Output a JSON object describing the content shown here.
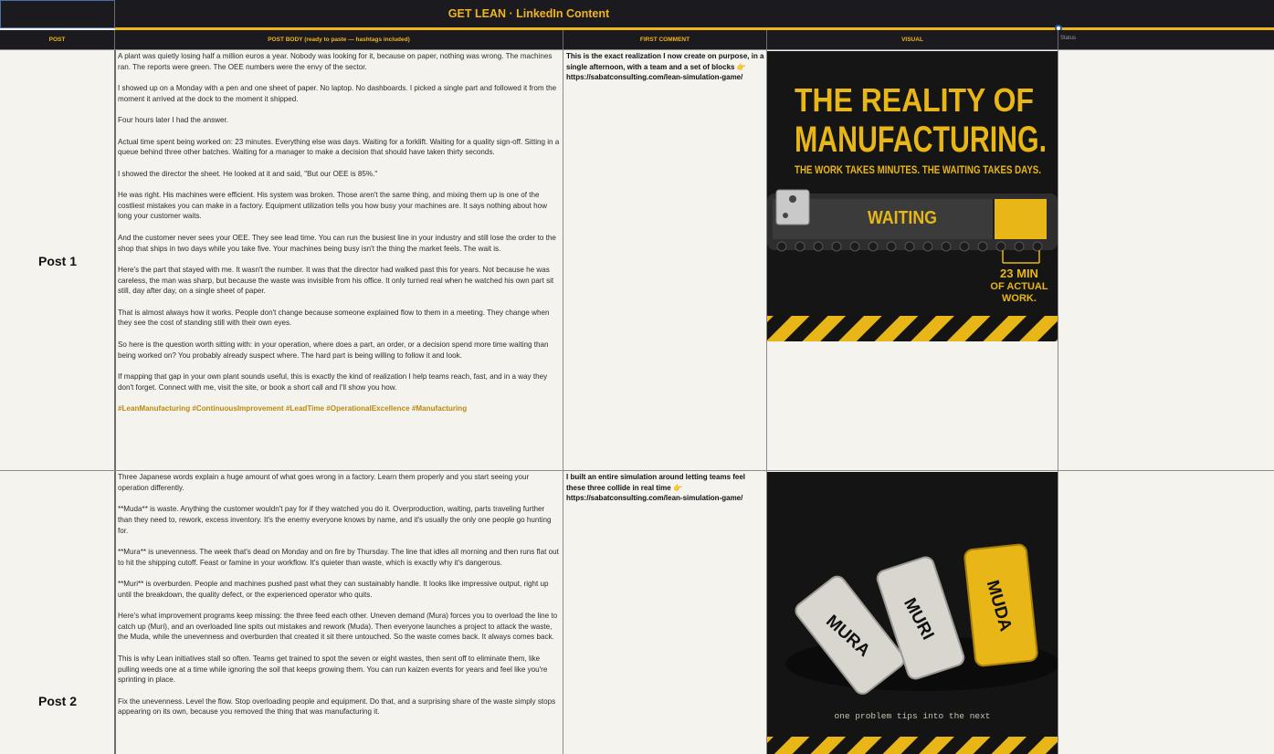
{
  "sheet": {
    "title": "GET LEAN  ·  LinkedIn Content",
    "headers": {
      "post": "POST",
      "body": "POST BODY  (ready to paste — hashtags included)",
      "comment": "FIRST COMMENT",
      "visual": "VISUAL",
      "extra": "Status"
    },
    "colors": {
      "accent": "#f0b51c",
      "header_bg": "#1b1b1f",
      "cell_bg": "#f4f3ee"
    }
  },
  "posts": [
    {
      "label": "Post 1",
      "paragraphs": [
        "A plant was quietly losing half a million euros a year. Nobody was looking for it, because on paper, nothing was wrong. The machines ran. The reports were green. The OEE numbers were the envy of the sector.",
        "I showed up on a Monday with a pen and one sheet of paper. No laptop. No dashboards. I picked a single part and followed it from the moment it arrived at the dock to the moment it shipped.",
        "Four hours later I had the answer.",
        "Actual time spent being worked on: 23 minutes. Everything else was days. Waiting for a forklift. Waiting for a quality sign-off. Sitting in a queue behind three other batches. Waiting for a manager to make a decision that should have taken thirty seconds.",
        "I showed the director the sheet. He looked at it and said, \"But our OEE is 85%.\"",
        "He was right. His machines were efficient. His system was broken. Those aren't the same thing, and mixing them up is one of the costliest mistakes you can make in a factory. Equipment utilization tells you how busy your machines are. It says nothing about how long your customer waits.",
        "And the customer never sees your OEE. They see lead time. You can run the busiest line in your industry and still lose the order to the shop that ships in two days while you take five. Your machines being busy isn't the thing the market feels. The wait is.",
        "Here's the part that stayed with me. It wasn't the number. It was that the director had walked past this for years. Not because he was careless, the man was sharp, but because the waste was invisible from his office. It only turned real when he watched his own part sit still, day after day, on a single sheet of paper.",
        "That is almost always how it works. People don't change because someone explained flow to them in a meeting. They change when they see the cost of standing still with their own eyes.",
        "So here is the question worth sitting with: in your operation, where does a part, an order, or a decision spend more time waiting than being worked on? You probably already suspect where. The hard part is being willing to follow it and look.",
        "If mapping that gap in your own plant sounds useful, this is exactly the kind of realization I help teams reach, fast, and in a way they don't forget. Connect with me, visit the site, or book a short call and I'll show you how."
      ],
      "hashtags": "#LeanManufacturing #ContinuousImprovement #LeadTime #OperationalExcellence #Manufacturing",
      "comment_text": "This is the exact realization I now create on purpose, in a single afternoon, with a team and a set of blocks",
      "comment_emoji": "👉",
      "comment_url": "https://sabatconsulting.com/lean-simulation-game/",
      "visual": {
        "headline_1": "THE REALITY OF",
        "headline_2": "MANUFACTURING.",
        "subline": "THE WORK TAKES MINUTES. THE WAITING TAKES DAYS.",
        "belt_label": "WAITING",
        "note_1": "23 MIN",
        "note_2": "OF ACTUAL",
        "note_3": "WORK."
      }
    },
    {
      "label": "Post 2",
      "paragraphs": [
        "Three Japanese words explain a huge amount of what goes wrong in a factory. Learn them properly and you start seeing your operation differently.",
        "**Muda** is waste. Anything the customer wouldn't pay for if they watched you do it. Overproduction, waiting, parts traveling further than they need to, rework, excess inventory. It's the enemy everyone knows by name, and it's usually the only one people go hunting for.",
        "**Mura** is unevenness. The week that's dead on Monday and on fire by Thursday. The line that idles all morning and then runs flat out to hit the shipping cutoff. Feast or famine in your workflow. It's quieter than waste, which is exactly why it's dangerous.",
        "**Muri** is overburden. People and machines pushed past what they can sustainably handle. It looks like impressive output, right up until the breakdown, the quality defect, or the experienced operator who quits.",
        "Here's what improvement programs keep missing: the three feed each other. Uneven demand (Mura) forces you to overload the line to catch up (Muri), and an overloaded line spits out mistakes and rework (Muda). Then everyone launches a project to attack the waste, the Muda, while the unevenness and overburden that created it sit there untouched. So the waste comes back. It always comes back.",
        "This is why Lean initiatives stall so often. Teams get trained to spot the seven or eight wastes, then sent off to eliminate them, like pulling weeds one at a time while ignoring the soil that keeps growing them. You can run kaizen events for years and feel like you're sprinting in place.",
        "Fix the unevenness. Level the flow. Stop overloading people and equipment. Do that, and a surprising share of the waste simply stops appearing on its own, because you removed the thing that was manufacturing it."
      ],
      "comment_text": "I built an entire simulation around letting teams feel these three collide in real time",
      "comment_emoji": "👉",
      "comment_url": "https://sabatconsulting.com/lean-simulation-game/",
      "visual": {
        "block_1": "MURA",
        "block_2": "MURI",
        "block_3": "MUDA",
        "caption": "one problem tips into the next"
      }
    }
  ]
}
